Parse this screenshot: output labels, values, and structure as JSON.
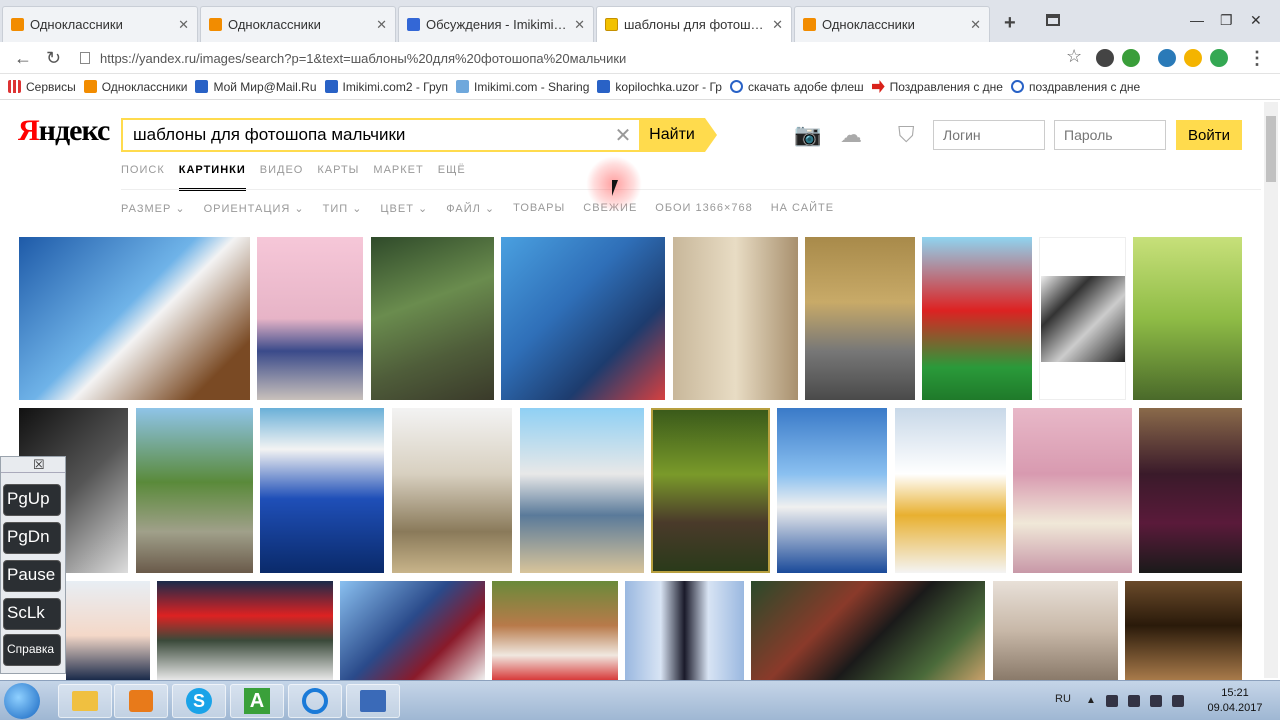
{
  "browser": {
    "tabs": [
      {
        "label": "Одноклассники",
        "icon": "odnoklassniki-icon",
        "active": false
      },
      {
        "label": "Одноклассники",
        "icon": "odnoklassniki-icon",
        "active": false
      },
      {
        "label": "Обсуждения - Imikimi.com2 - Г",
        "icon": "imikimi-icon",
        "active": false
      },
      {
        "label": "шаблоны для фотошопа мальч",
        "icon": "yandex-images-icon",
        "active": true
      },
      {
        "label": "Одноклассники",
        "icon": "odnoklassniki-icon",
        "active": false
      }
    ],
    "url": "https://yandex.ru/images/search?p=1&text=шаблоны%20для%20фотошопа%20мальчики",
    "bookmarks": [
      {
        "label": "Сервисы",
        "icon": "apps-icon"
      },
      {
        "label": "Одноклассники",
        "icon": "odnoklassniki-icon"
      },
      {
        "label": "Мой Мир@Mail.Ru",
        "icon": "mailru-icon"
      },
      {
        "label": "Imikimi.com2 - Груп",
        "icon": "imikimi-icon"
      },
      {
        "label": "Imikimi.com - Sharing",
        "icon": "imikimi-icon"
      },
      {
        "label": "kopilochka.uzor - Гр",
        "icon": "mailru-icon"
      },
      {
        "label": "скачать адобе флеш",
        "icon": "search-icon"
      },
      {
        "label": "Поздравления с дне",
        "icon": "arrow-icon"
      },
      {
        "label": "поздравления с дне",
        "icon": "search-icon"
      }
    ]
  },
  "yandex": {
    "logo": "Яндекс",
    "query": "шаблоны для фотошопа мальчики",
    "find_label": "Найти",
    "login_placeholder": "Логин",
    "password_placeholder": "Пароль",
    "login_button": "Войти",
    "services": [
      "ПОИСК",
      "КАРТИНКИ",
      "ВИДЕО",
      "КАРТЫ",
      "МАРКЕТ",
      "ЕЩЁ"
    ],
    "active_service": "КАРТИНКИ",
    "filters": [
      "РАЗМЕР ⌄",
      "ОРИЕНТАЦИЯ ⌄",
      "ТИП ⌄",
      "ЦВЕТ ⌄",
      "ФАЙЛ ⌄",
      "ТОВАРЫ",
      "СВЕЖИЕ",
      "ОБОИ 1366×768",
      "НА САЙТЕ"
    ]
  },
  "keyboard_panel": {
    "keys": [
      "PgUp",
      "PgDn",
      "Pause",
      "ScLk",
      "Справка"
    ]
  },
  "taskbar": {
    "lang": "RU",
    "time": "15:21",
    "date": "09.04.2017"
  },
  "colors": {
    "accent": "#ffdb4d",
    "logo_red": "#ff0000"
  }
}
